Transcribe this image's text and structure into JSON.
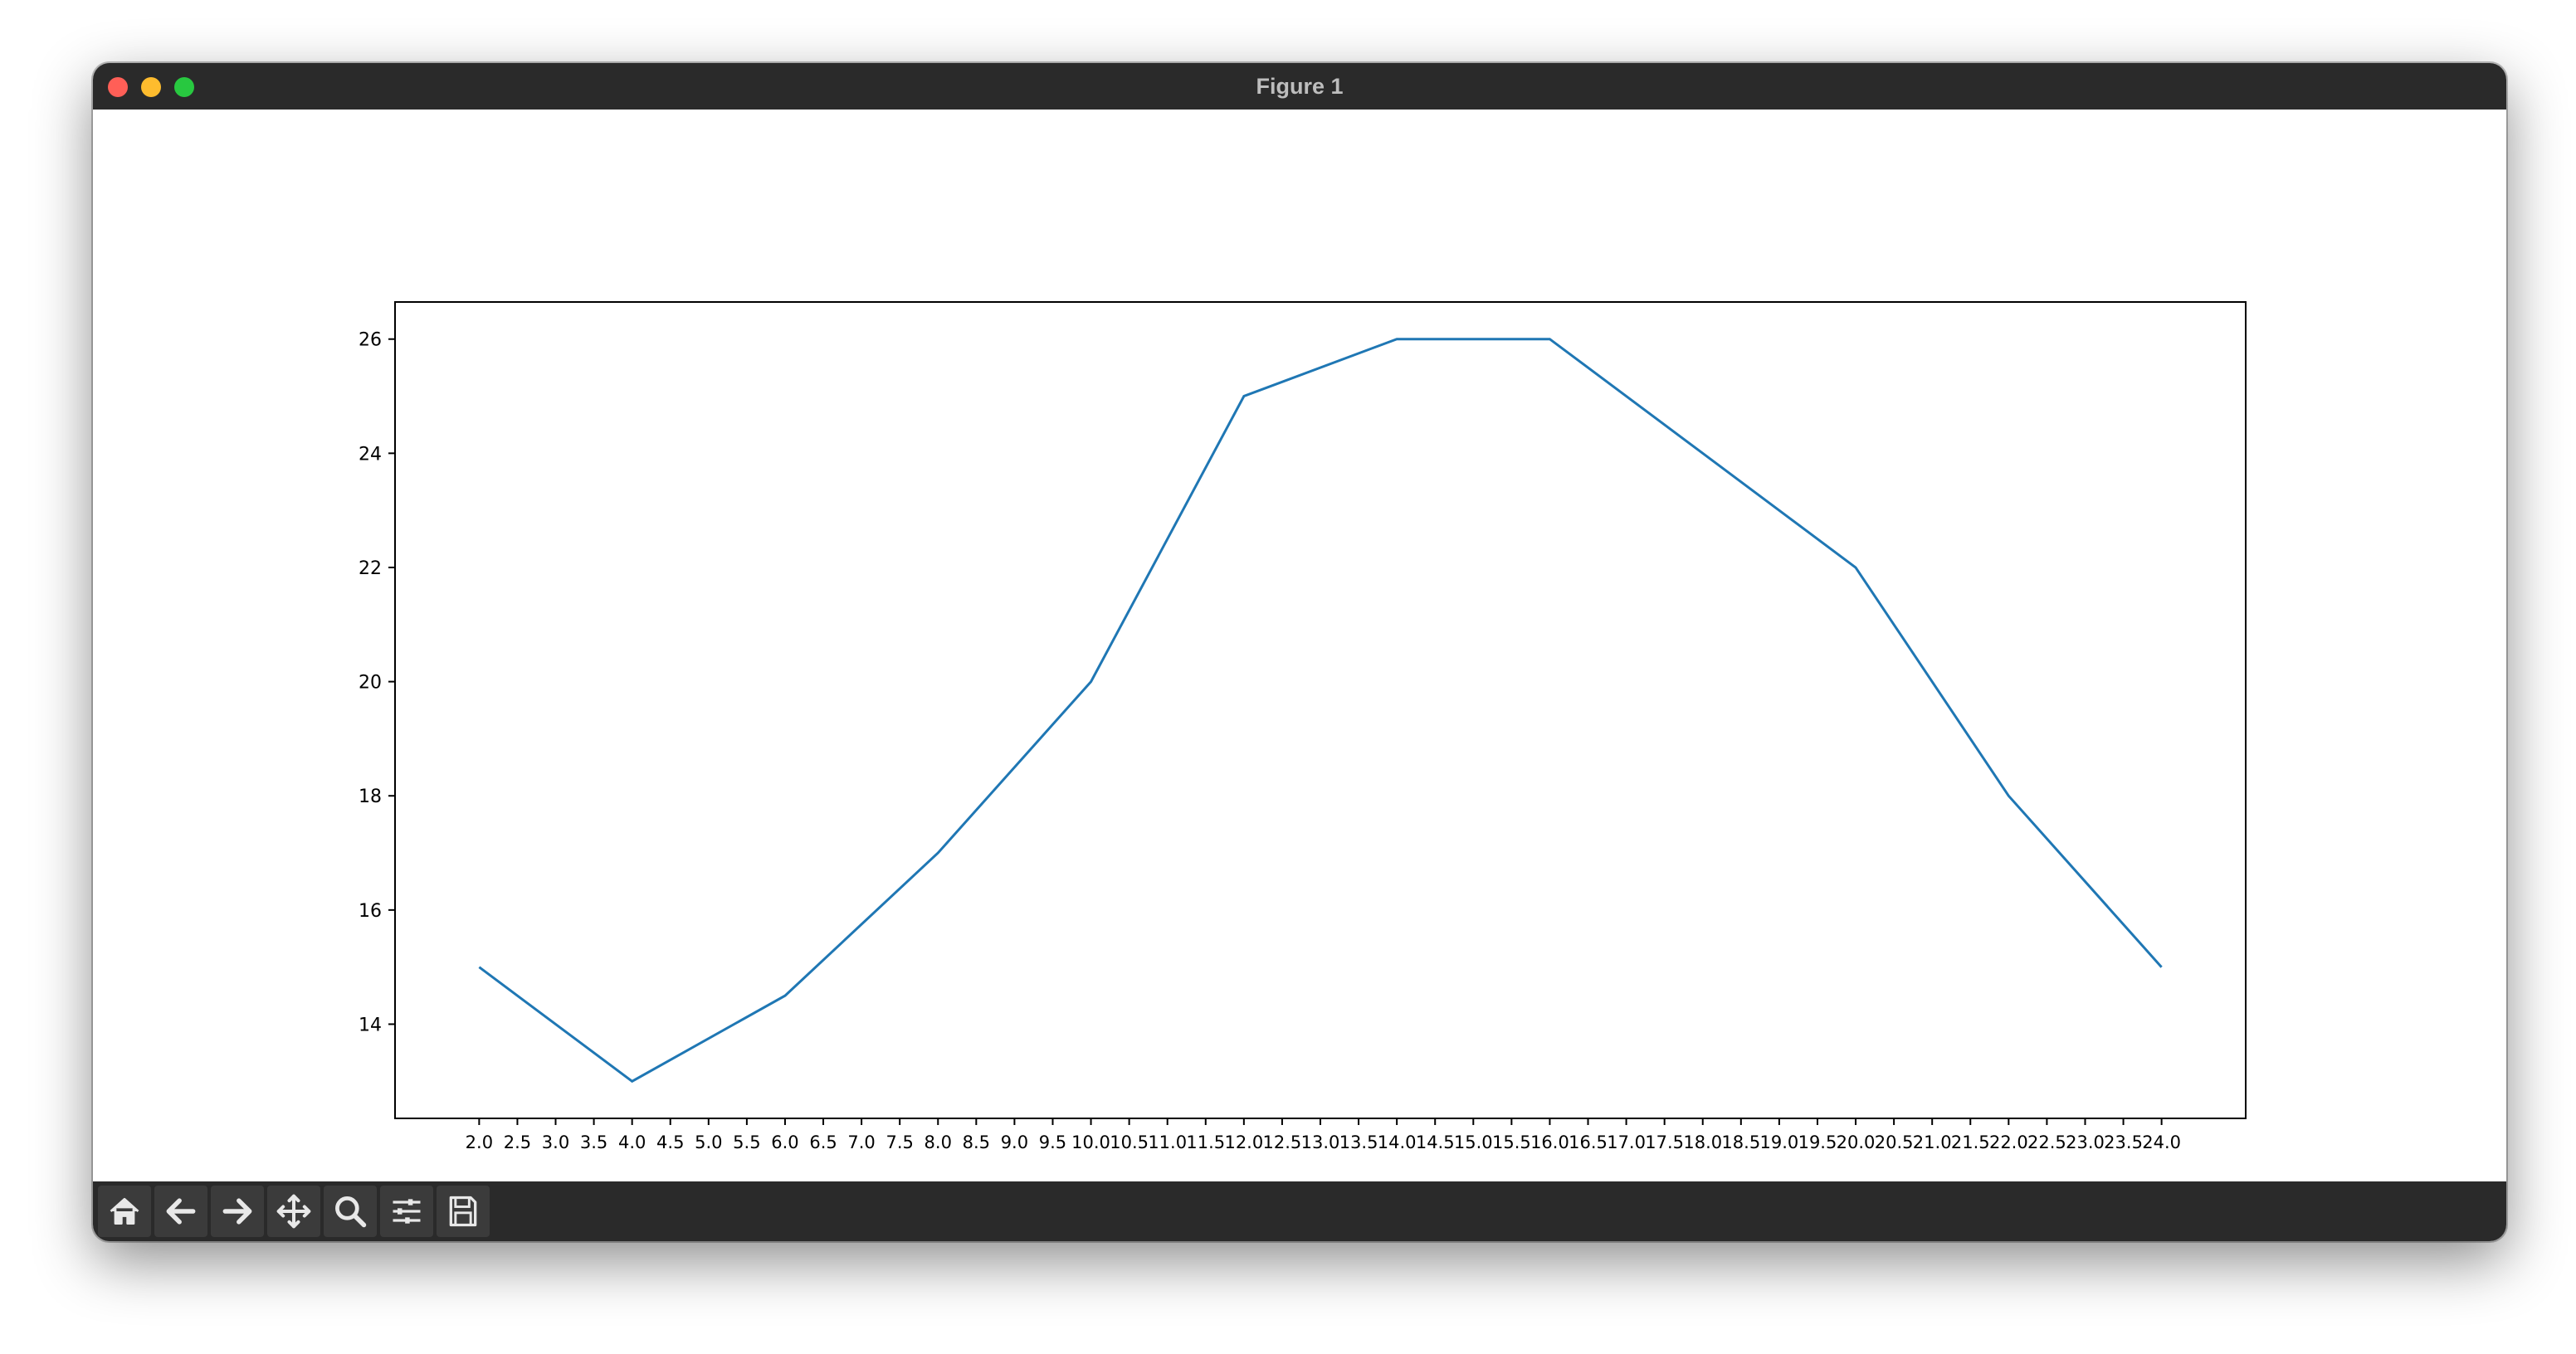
{
  "window": {
    "title": "Figure 1"
  },
  "colors": {
    "close": "#ff5f57",
    "minimize": "#febc2e",
    "maximize": "#28c840",
    "line": "#1f77b4"
  },
  "toolbar": {
    "tools": [
      {
        "name": "home-icon"
      },
      {
        "name": "back-icon"
      },
      {
        "name": "forward-icon"
      },
      {
        "name": "pan-icon"
      },
      {
        "name": "zoom-icon"
      },
      {
        "name": "configure-subplots-icon"
      },
      {
        "name": "save-icon"
      }
    ]
  },
  "chart_data": {
    "type": "line",
    "x": [
      2,
      4,
      6,
      8,
      10,
      12,
      14,
      16,
      18,
      20,
      22,
      24
    ],
    "values": [
      15,
      13,
      14.5,
      17,
      20,
      25,
      26,
      26,
      24,
      22,
      18,
      15
    ],
    "xticks": [
      "2.0",
      "2.5",
      "3.0",
      "3.5",
      "4.0",
      "4.5",
      "5.0",
      "5.5",
      "6.0",
      "6.5",
      "7.0",
      "7.5",
      "8.0",
      "8.5",
      "9.0",
      "9.5",
      "10.0",
      "10.5",
      "11.0",
      "11.5",
      "12.0",
      "12.5",
      "13.0",
      "13.5",
      "14.0",
      "14.5",
      "15.0",
      "15.5",
      "16.0",
      "16.5",
      "17.0",
      "17.5",
      "18.0",
      "18.5",
      "19.0",
      "19.5",
      "20.0",
      "20.5",
      "21.0",
      "21.5",
      "22.0",
      "22.5",
      "23.0",
      "23.5",
      "24.0"
    ],
    "yticks": [
      "14",
      "16",
      "18",
      "20",
      "22",
      "24",
      "26"
    ],
    "xlim": [
      0.9,
      25.1
    ],
    "ylim": [
      12.35,
      26.65
    ],
    "title": "",
    "xlabel": "",
    "ylabel": "",
    "grid": false
  }
}
